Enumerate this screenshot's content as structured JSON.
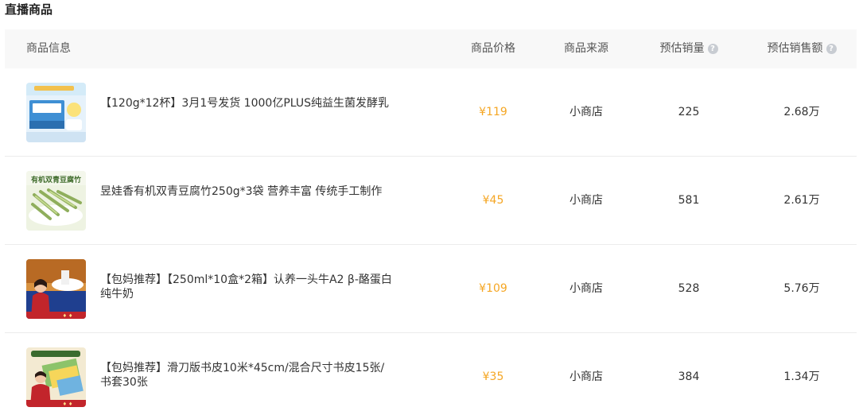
{
  "section": {
    "title": "直播商品"
  },
  "columns": {
    "info": "商品信息",
    "price": "商品价格",
    "source": "商品来源",
    "volume": "预估销量",
    "amount": "预估销售额"
  },
  "rows": [
    {
      "name": "【120g*12杯】3月1号发货 1000亿PLUS纯益生菌发酵乳",
      "price": "¥119",
      "source": "小商店",
      "volume": "225",
      "amount": "2.68万",
      "thumb_icon": "yogurt-box-image"
    },
    {
      "name": "昱娃香有机双青豆腐竹250g*3袋 营养丰富 传统手工制作",
      "price": "¥45",
      "source": "小商店",
      "volume": "581",
      "amount": "2.61万",
      "thumb_icon": "tofu-skin-image",
      "thumb_text": "有机双青豆腐竹"
    },
    {
      "name": "【包妈推荐】【250ml*10盒*2箱】认养一头牛A2 β-酪蛋白纯牛奶",
      "price": "¥109",
      "source": "小商店",
      "volume": "528",
      "amount": "5.76万",
      "thumb_icon": "milk-presenter-image"
    },
    {
      "name": "【包妈推荐】滑刀版书皮10米*45cm/混合尺寸书皮15张/书套30张",
      "price": "¥35",
      "source": "小商店",
      "volume": "384",
      "amount": "1.34万",
      "thumb_icon": "book-cover-presenter-image"
    }
  ],
  "colors": {
    "price": "#f5a623",
    "header_bg": "#f8f8f8",
    "help_icon": "#c8ccd2"
  }
}
